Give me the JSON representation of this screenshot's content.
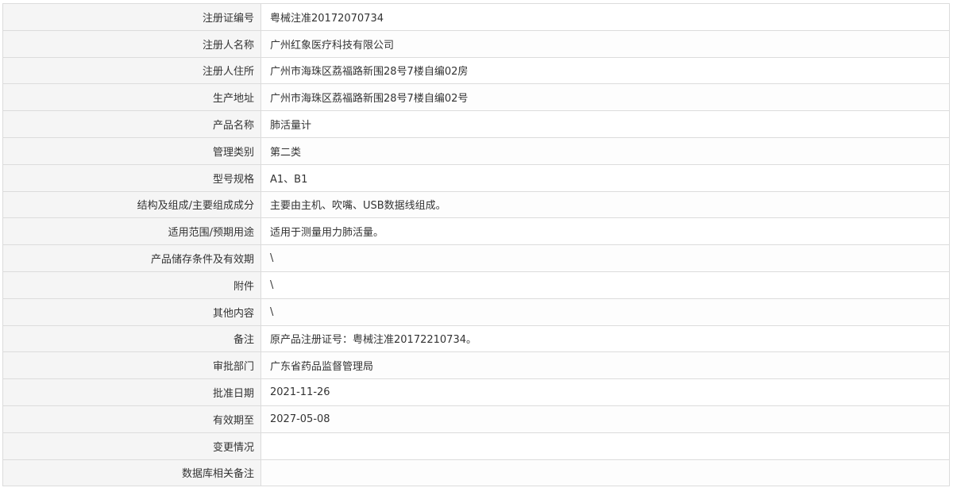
{
  "record": {
    "rows": [
      {
        "label": "注册证编号",
        "value": "粤械注准20172070734"
      },
      {
        "label": "注册人名称",
        "value": "广州红象医疗科技有限公司"
      },
      {
        "label": "注册人住所",
        "value": "广州市海珠区荔福路新围28号7楼自编02房"
      },
      {
        "label": "生产地址",
        "value": "广州市海珠区荔福路新围28号7楼自编02号"
      },
      {
        "label": "产品名称",
        "value": "肺活量计"
      },
      {
        "label": "管理类别",
        "value": "第二类"
      },
      {
        "label": "型号规格",
        "value": "A1、B1"
      },
      {
        "label": "结构及组成/主要组成成分",
        "value": "主要由主机、吹嘴、USB数据线组成。"
      },
      {
        "label": "适用范围/预期用途",
        "value": "适用于测量用力肺活量。"
      },
      {
        "label": "产品储存条件及有效期",
        "value": "\\"
      },
      {
        "label": "附件",
        "value": "\\"
      },
      {
        "label": "其他内容",
        "value": "\\"
      },
      {
        "label": "备注",
        "value": "原产品注册证号：粤械注准20172210734。"
      },
      {
        "label": "审批部门",
        "value": "广东省药品监督管理局"
      },
      {
        "label": "批准日期",
        "value": "2021-11-26"
      },
      {
        "label": "有效期至",
        "value": "2027-05-08"
      },
      {
        "label": "变更情况",
        "value": ""
      },
      {
        "label": "数据库相关备注",
        "value": ""
      }
    ]
  }
}
